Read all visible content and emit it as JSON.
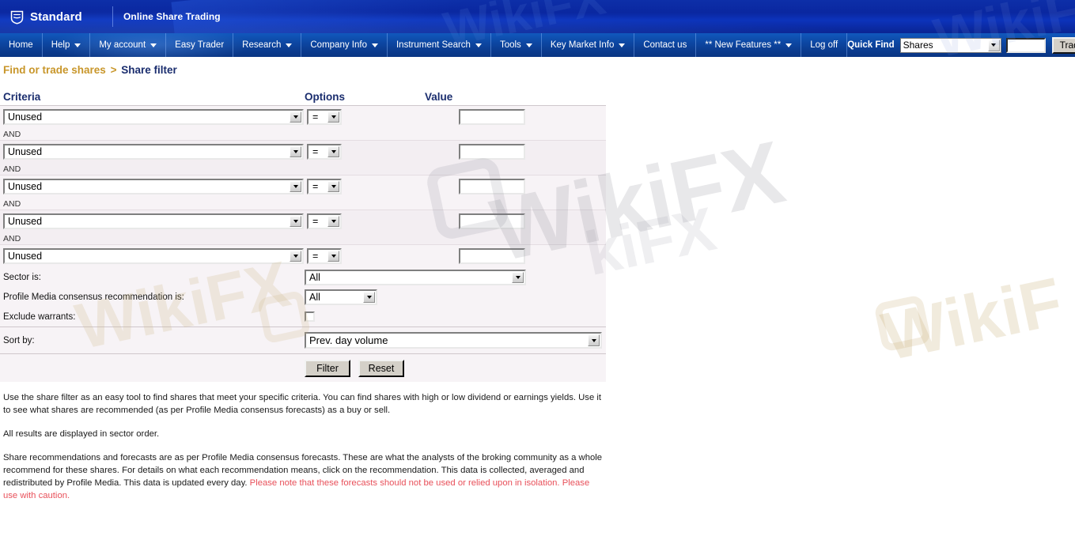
{
  "header": {
    "brand": "Standard",
    "logo_icon": "shield-logo-icon",
    "subtitle": "Online Share Trading"
  },
  "nav": {
    "items": [
      {
        "label": "Home",
        "has_caret": false
      },
      {
        "label": "Help",
        "has_caret": true
      },
      {
        "label": "My account",
        "has_caret": true
      },
      {
        "label": "Easy Trader",
        "has_caret": false
      },
      {
        "label": "Research",
        "has_caret": true
      },
      {
        "label": "Company Info",
        "has_caret": true
      },
      {
        "label": "Instrument Search",
        "has_caret": true
      },
      {
        "label": "Tools",
        "has_caret": true
      },
      {
        "label": "Key Market Info",
        "has_caret": true
      },
      {
        "label": "Contact us",
        "has_caret": false
      },
      {
        "label": "** New Features **",
        "has_caret": true
      },
      {
        "label": "Log off",
        "has_caret": false
      }
    ],
    "quick_find": {
      "label": "Quick Find",
      "select_value": "Shares",
      "input_value": "",
      "input_placeholder": "",
      "button_label": "Trade"
    }
  },
  "breadcrumb": {
    "parent": "Find or trade shares",
    "separator": ">",
    "current": "Share filter"
  },
  "table": {
    "headers": {
      "criteria": "Criteria",
      "options": "Options",
      "value": "Value"
    },
    "and_label": "AND",
    "rows": [
      {
        "criteria": "Unused",
        "operator": "=",
        "value": ""
      },
      {
        "criteria": "Unused",
        "operator": "=",
        "value": ""
      },
      {
        "criteria": "Unused",
        "operator": "=",
        "value": ""
      },
      {
        "criteria": "Unused",
        "operator": "=",
        "value": ""
      },
      {
        "criteria": "Unused",
        "operator": "=",
        "value": ""
      }
    ]
  },
  "options": {
    "sector": {
      "label": "Sector is:",
      "value": "All"
    },
    "recommendation": {
      "label": "Profile Media consensus recommendation is:",
      "value": "All"
    },
    "exclude_warrants": {
      "label": "Exclude warrants:",
      "checked": false
    }
  },
  "sort": {
    "label": "Sort by:",
    "value": "Prev. day volume"
  },
  "buttons": {
    "filter": "Filter",
    "reset": "Reset"
  },
  "copy": {
    "p1": "Use the share filter as an easy tool to find shares that meet your specific criteria. You can find shares with high or low dividend or earnings yields. Use it to see what shares are recommended (as per Profile Media consensus forecasts) as a buy or sell.",
    "p2": "All results are displayed in sector order.",
    "p3_black": "Share recommendations and forecasts are as per Profile Media consensus forecasts. These are what the analysts of the broking community as a whole recommend for these shares. For details on what each recommendation means, click on the recommendation. This data is collected, averaged and redistributed by Profile Media. This data is updated every day. ",
    "p3_red": "Please note that these forecasts should not be used or relied upon in isolation. Please use with caution."
  },
  "watermark": {
    "text": "WikiFX"
  },
  "colors": {
    "header_blue": "#0a27a0",
    "nav_blue": "#0d49a6",
    "breadcrumb_gold": "#c8962a",
    "title_navy": "#1a2d6e",
    "warning_red": "#e8505a",
    "panel_bg": "#f5f1f4"
  }
}
